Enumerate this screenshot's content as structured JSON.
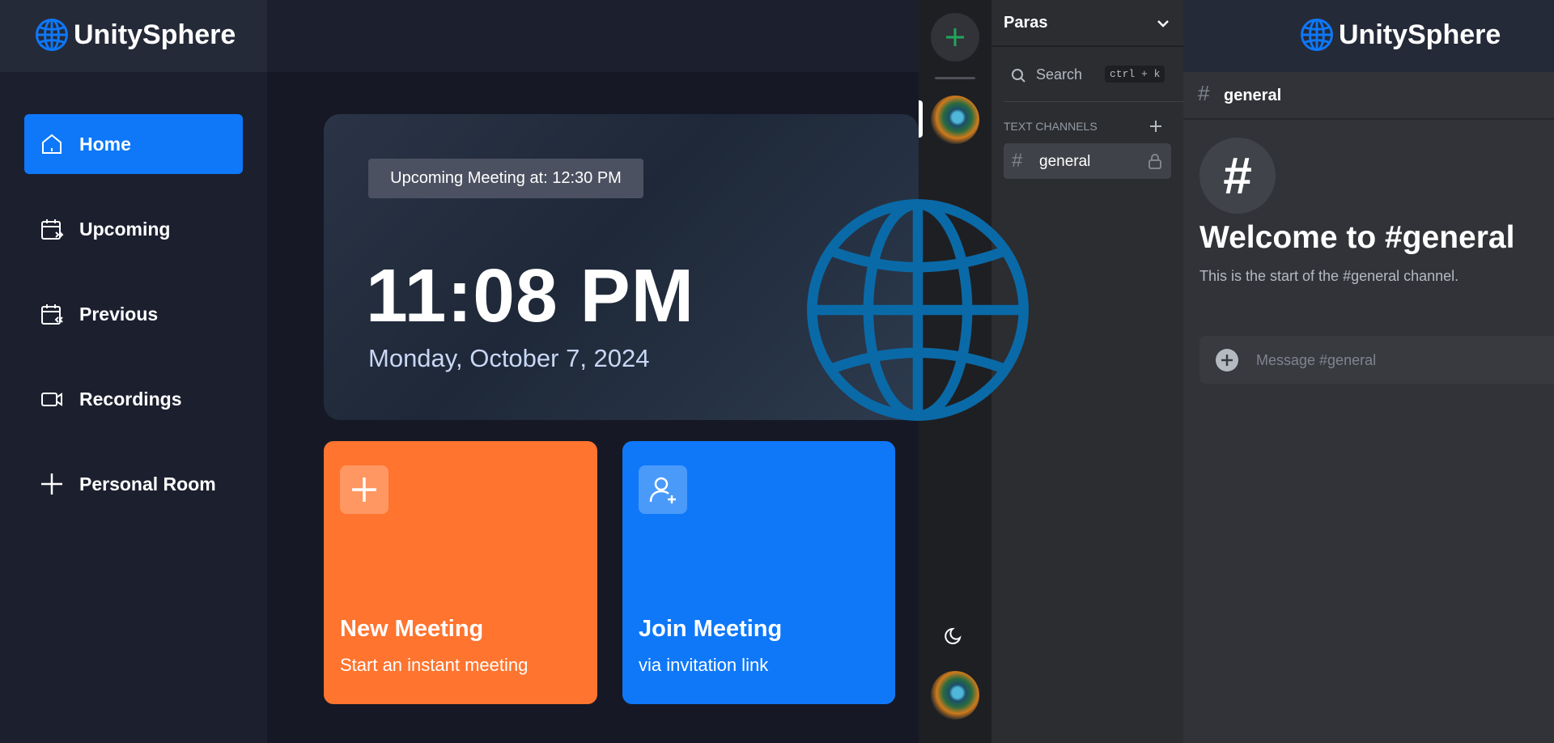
{
  "brand": {
    "name": "UnitySphere",
    "color": "#0e78f9"
  },
  "sidebar": {
    "items": [
      {
        "label": "Home",
        "icon": "home-icon",
        "active": true
      },
      {
        "label": "Upcoming",
        "icon": "calendar-upcoming-icon",
        "active": false
      },
      {
        "label": "Previous",
        "icon": "calendar-previous-icon",
        "active": false
      },
      {
        "label": "Recordings",
        "icon": "video-icon",
        "active": false
      },
      {
        "label": "Personal Room",
        "icon": "plus-icon",
        "active": false
      }
    ]
  },
  "hero": {
    "upcoming": "Upcoming Meeting at: 12:30 PM",
    "time": "11:08 PM",
    "date": "Monday, October 7, 2024"
  },
  "cards": [
    {
      "title": "New Meeting",
      "subtitle": "Start an instant meeting",
      "icon": "plus-icon",
      "color": "#ff742e"
    },
    {
      "title": "Join Meeting",
      "subtitle": "via invitation link",
      "icon": "add-user-icon",
      "color": "#0e78f9"
    }
  ],
  "server": {
    "name": "Paras",
    "search_label": "Search",
    "search_shortcut": "ctrl + k",
    "section_label": "TEXT CHANNELS",
    "channels": [
      {
        "name": "general",
        "locked": true
      }
    ]
  },
  "chat": {
    "channel": "general",
    "welcome_title": "Welcome to #general",
    "welcome_sub": "This is the start of the #general channel.",
    "input_placeholder": "Message #general"
  },
  "colors": {
    "accent_green": "#23a55a",
    "orange": "#ff742e",
    "blue": "#0e78f9"
  }
}
